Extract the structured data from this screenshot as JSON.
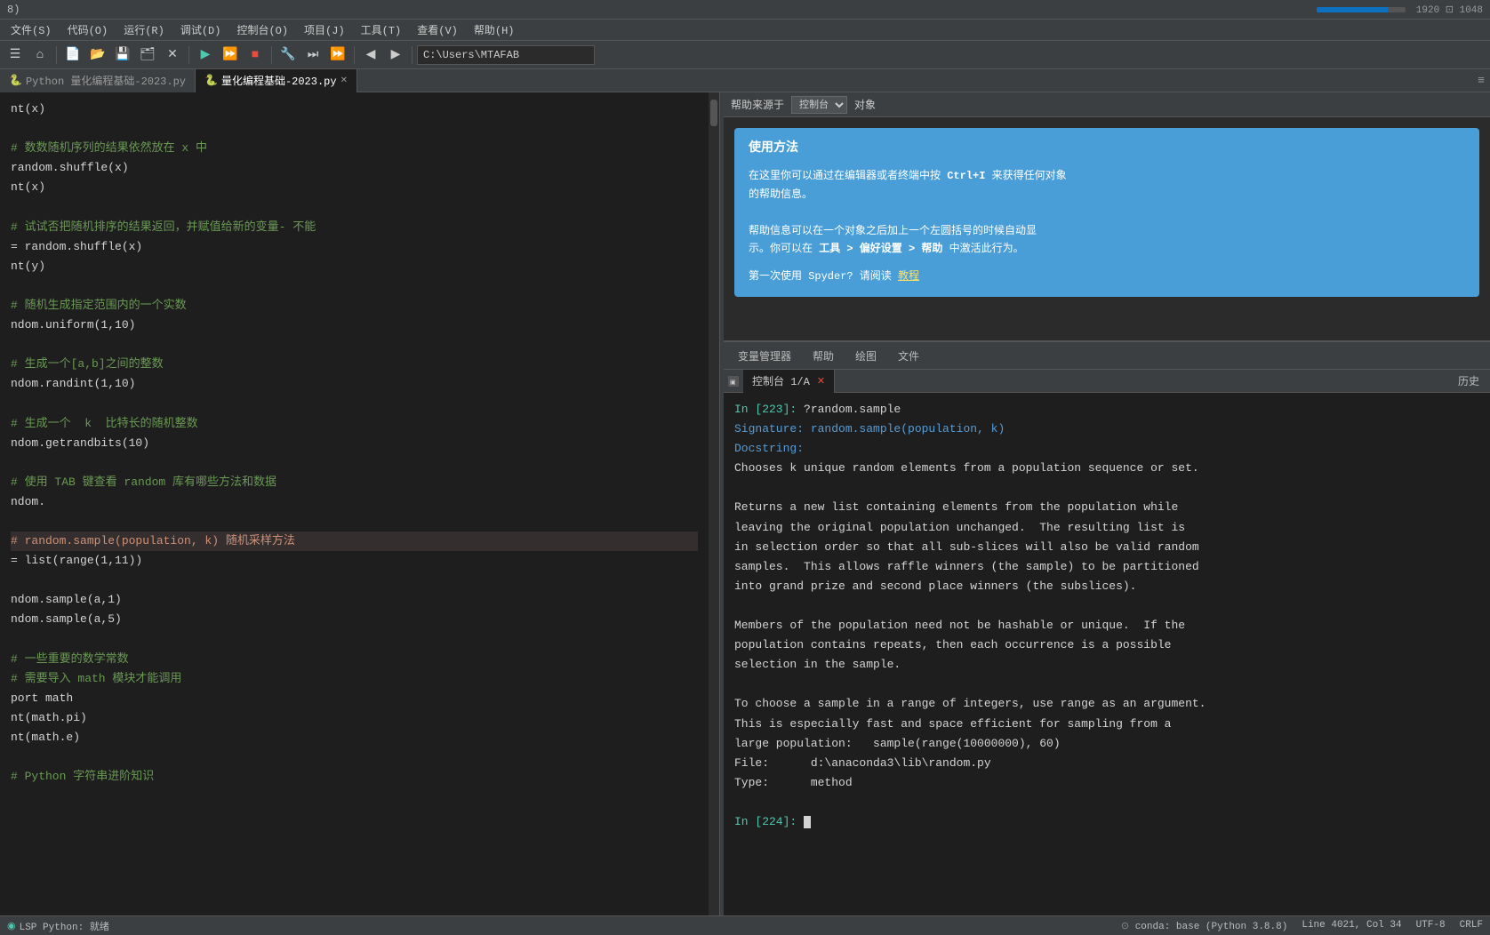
{
  "titlebar": {
    "text": "8)"
  },
  "menubar": {
    "items": [
      "文件(S)",
      "代码(O)",
      "运行(R)",
      "调试(D)",
      "控制台(O)",
      "项目(J)",
      "工具(T)",
      "查看(V)",
      "帮助(H)"
    ]
  },
  "toolbar": {
    "path": "C:\\Users\\MTAFAB"
  },
  "editor": {
    "tabs": [
      {
        "label": "量化编程基础-2023.py",
        "active": false
      },
      {
        "label": "量化编程基础-2023.py",
        "active": true,
        "closable": true
      }
    ],
    "lines": [
      {
        "text": "nt(x)",
        "style": "normal"
      },
      {
        "text": "",
        "style": "empty"
      },
      {
        "text": "# 数数随机序列的结果依然放在 x 中",
        "style": "comment"
      },
      {
        "text": "random.shuffle(x)",
        "style": "normal"
      },
      {
        "text": "nt(x)",
        "style": "normal"
      },
      {
        "text": "",
        "style": "empty"
      },
      {
        "text": "# 试试否把随机排序的结果返回，并赋值给新的变量- 不能",
        "style": "comment"
      },
      {
        "text": "= random.shuffle(x)",
        "style": "normal"
      },
      {
        "text": "nt(y)",
        "style": "normal"
      },
      {
        "text": "",
        "style": "empty"
      },
      {
        "text": "# 随机生成指定范围内的一个实数",
        "style": "comment"
      },
      {
        "text": "ndom.uniform(1,10)",
        "style": "normal"
      },
      {
        "text": "",
        "style": "empty"
      },
      {
        "text": "# 生成一个[a,b]之间的整数",
        "style": "comment"
      },
      {
        "text": "ndom.randint(1,10)",
        "style": "normal"
      },
      {
        "text": "",
        "style": "empty"
      },
      {
        "text": "# 生成一个  k  比特长的随机整数",
        "style": "comment"
      },
      {
        "text": "ndom.getrandbits(10)",
        "style": "normal"
      },
      {
        "text": "",
        "style": "empty"
      },
      {
        "text": "# 使用 TAB 键查看 random 库有哪些方法和数据",
        "style": "comment"
      },
      {
        "text": "ndom.",
        "style": "normal"
      },
      {
        "text": "",
        "style": "empty"
      },
      {
        "text": "# random.sample(population, k) 随机采样方法",
        "style": "highlight"
      },
      {
        "text": "= list(range(1,11))",
        "style": "normal"
      },
      {
        "text": "",
        "style": "empty"
      },
      {
        "text": "ndom.sample(a,1)",
        "style": "normal"
      },
      {
        "text": "ndom.sample(a,5)",
        "style": "normal"
      },
      {
        "text": "",
        "style": "empty"
      },
      {
        "text": "# 一些重要的数学常数",
        "style": "comment"
      },
      {
        "text": "# 需要导入 math 模块才能调用",
        "style": "comment"
      },
      {
        "text": "port math",
        "style": "normal"
      },
      {
        "text": "nt(math.pi)",
        "style": "normal"
      },
      {
        "text": "nt(math.e)",
        "style": "normal"
      },
      {
        "text": "",
        "style": "empty"
      },
      {
        "text": "# Python 字符串进阶知识",
        "style": "comment"
      }
    ]
  },
  "help_panel": {
    "source_label": "帮助来源于",
    "source_options": [
      "控制台",
      "对象"
    ],
    "tooltip": {
      "title": "使用方法",
      "lines": [
        "在这里你可以通过在编辑器或者终端中按 Ctrl+I 来获得任何对象",
        "的帮助信息。",
        "",
        "帮助信息可以在一个对象之后加上一个左圆括号的时候自动显",
        "示。你可以在 工具 > 偏好设置 > 帮助 中激活此行为。"
      ],
      "footer": "第一次使用 Spyder? 请阅读",
      "link": "教程"
    }
  },
  "bottom_tabs": {
    "items": [
      "变量管理器",
      "帮助",
      "绘图",
      "文件"
    ]
  },
  "console": {
    "tab_label": "控制台 1/A",
    "history_label": "历史",
    "lines": [
      {
        "text": "In [223]: ?random.sample",
        "style": "input"
      },
      {
        "text": "Signature: random.sample(population, k)",
        "style": "sig"
      },
      {
        "text": "Docstring:",
        "style": "sig"
      },
      {
        "text": "Chooses k unique random elements from a population sequence or set.",
        "style": "doc"
      },
      {
        "text": "",
        "style": "empty"
      },
      {
        "text": "Returns a new list containing elements from the population while",
        "style": "doc"
      },
      {
        "text": "leaving the original population unchanged.  The resulting list is",
        "style": "doc"
      },
      {
        "text": "in selection order so that all sub-slices will also be valid random",
        "style": "doc"
      },
      {
        "text": "samples.  This allows raffle winners (the sample) to be partitioned",
        "style": "doc"
      },
      {
        "text": "into grand prize and second place winners (the subslices).",
        "style": "doc"
      },
      {
        "text": "",
        "style": "empty"
      },
      {
        "text": "Members of the population need not be hashable or unique.  If the",
        "style": "doc"
      },
      {
        "text": "population contains repeats, then each occurrence is a possible",
        "style": "doc"
      },
      {
        "text": "selection in the sample.",
        "style": "doc"
      },
      {
        "text": "",
        "style": "empty"
      },
      {
        "text": "To choose a sample in a range of integers, use range as an argument.",
        "style": "doc"
      },
      {
        "text": "This is especially fast and space efficient for sampling from a",
        "style": "doc"
      },
      {
        "text": "large population:   sample(range(10000000), 60)",
        "style": "doc"
      },
      {
        "text": "File:      d:\\anaconda3\\lib\\random.py",
        "style": "doc"
      },
      {
        "text": "Type:      method",
        "style": "doc"
      },
      {
        "text": "",
        "style": "empty"
      },
      {
        "text": "In [224]:",
        "style": "input"
      }
    ]
  },
  "statusbar": {
    "lsp": "LSP Python: 就绪",
    "conda": "conda: base (Python 3.8.8)",
    "line": "Line 4021",
    "col": "Col 34",
    "encoding": "UTF-8",
    "eol": "CRLF"
  }
}
